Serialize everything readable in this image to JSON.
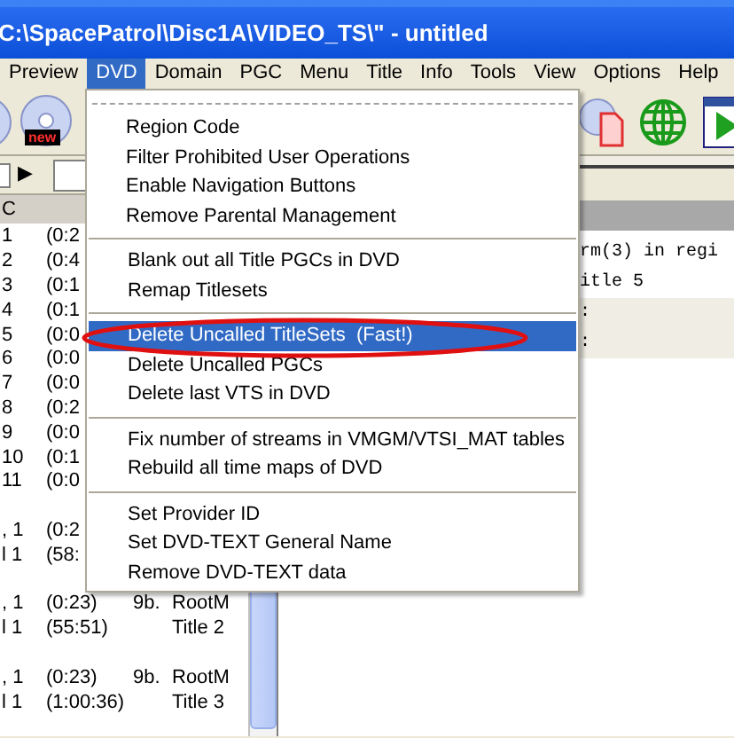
{
  "window": {
    "title": "C:\\SpacePatrol\\Disc1A\\VIDEO_TS\\\" - untitled"
  },
  "menubar": [
    {
      "label": "Preview",
      "selected": false
    },
    {
      "label": "DVD",
      "selected": true
    },
    {
      "label": "Domain",
      "selected": false
    },
    {
      "label": "PGC",
      "selected": false
    },
    {
      "label": "Menu",
      "selected": false
    },
    {
      "label": "Title",
      "selected": false
    },
    {
      "label": "Info",
      "selected": false
    },
    {
      "label": "Tools",
      "selected": false
    },
    {
      "label": "View",
      "selected": false
    },
    {
      "label": "Options",
      "selected": false
    },
    {
      "label": "Help",
      "selected": false
    }
  ],
  "toolbar": {
    "badge": "new"
  },
  "nav_row": {
    "arrow": "▶"
  },
  "list": {
    "header": "C",
    "rows": [
      {
        "kind": "row",
        "cells": [
          "1",
          "(0:2"
        ]
      },
      {
        "kind": "row",
        "cells": [
          "2",
          "(0:4"
        ]
      },
      {
        "kind": "row",
        "cells": [
          "3",
          "(0:1"
        ]
      },
      {
        "kind": "row",
        "cells": [
          "4",
          "(0:1"
        ]
      },
      {
        "kind": "row",
        "cells": [
          "5",
          "(0:0"
        ]
      },
      {
        "kind": "row",
        "cells": [
          "6",
          "(0:0"
        ]
      },
      {
        "kind": "row",
        "cells": [
          "7",
          "(0:0"
        ]
      },
      {
        "kind": "row",
        "cells": [
          "8",
          "(0:2"
        ]
      },
      {
        "kind": "row",
        "cells": [
          "9",
          "(0:0"
        ]
      },
      {
        "kind": "row",
        "cells": [
          "10",
          "(0:1"
        ]
      },
      {
        "kind": "row",
        "cells": [
          "11",
          "(0:0"
        ]
      },
      {
        "kind": "spacer"
      },
      {
        "kind": "row",
        "cells": [
          ", 1",
          "(0:2"
        ]
      },
      {
        "kind": "row",
        "cells": [
          "l 1",
          "(58:"
        ]
      },
      {
        "kind": "spacer"
      },
      {
        "kind": "row",
        "cells": [
          ", 1",
          "(0:23)",
          "9b.",
          "RootM"
        ]
      },
      {
        "kind": "row",
        "cells": [
          "l 1",
          "(55:51)",
          "",
          "Title 2"
        ]
      },
      {
        "kind": "spacer"
      },
      {
        "kind": "row",
        "cells": [
          ", 1",
          "(0:23)",
          "9b.",
          "RootM"
        ]
      },
      {
        "kind": "row",
        "cells": [
          "l 1",
          "(1:00:36)",
          "",
          "Title 3"
        ]
      }
    ]
  },
  "code_panel": {
    "lines": [
      "rm(3) in regi",
      "itle 5",
      ":",
      ":"
    ]
  },
  "dvd_menu": {
    "groups": [
      {
        "items": [
          {
            "label": "Region Code",
            "selected": false
          },
          {
            "label": "Filter Prohibited User Operations",
            "selected": false
          },
          {
            "label": "Enable Navigation Buttons",
            "selected": false
          },
          {
            "label": "Remove Parental Management",
            "selected": false
          }
        ]
      },
      {
        "items": [
          {
            "label": "Blank out all Title PGCs in DVD",
            "selected": false
          },
          {
            "label": "Remap Titlesets",
            "selected": false
          }
        ]
      },
      {
        "items": [
          {
            "label": "Delete Uncalled TitleSets  (Fast!)",
            "selected": true
          },
          {
            "label": "Delete Uncalled PGCs",
            "selected": false
          },
          {
            "label": "Delete last VTS in DVD",
            "selected": false
          }
        ]
      },
      {
        "items": [
          {
            "label": "Fix number of streams in VMGM/VTSI_MAT tables",
            "selected": false
          },
          {
            "label": "Rebuild all time maps of DVD",
            "selected": false
          }
        ]
      },
      {
        "items": [
          {
            "label": "Set Provider ID",
            "selected": false
          },
          {
            "label": "Set DVD-TEXT General Name",
            "selected": false
          },
          {
            "label": "Remove DVD-TEXT data",
            "selected": false
          }
        ]
      }
    ]
  }
}
